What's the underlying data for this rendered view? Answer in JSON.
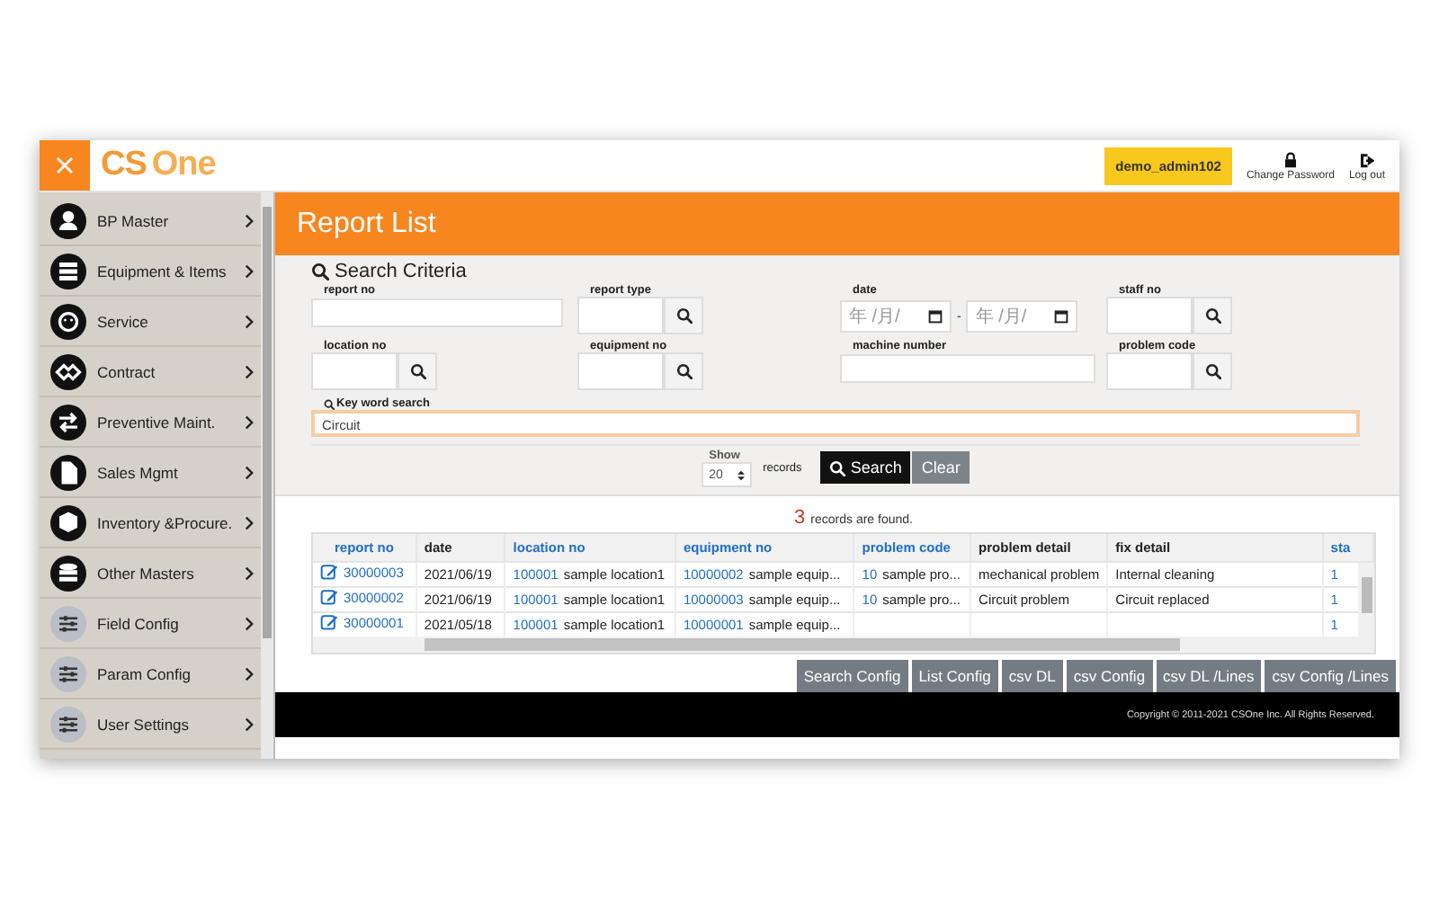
{
  "header": {
    "logo": [
      "CS",
      "One"
    ],
    "user": "demo_admin102",
    "actions": [
      {
        "kind": "password",
        "label": "Change Password"
      },
      {
        "kind": "logout",
        "label": "Log out"
      }
    ]
  },
  "sidebar": {
    "items": [
      {
        "label": "BP Master",
        "kind": "main"
      },
      {
        "label": "Equipment & Items",
        "kind": "main"
      },
      {
        "label": "Service",
        "kind": "main"
      },
      {
        "label": "Contract",
        "kind": "main"
      },
      {
        "label": "Preventive Maint.",
        "kind": "main"
      },
      {
        "label": "Sales Mgmt",
        "kind": "main"
      },
      {
        "label": "Inventory &Procure.",
        "kind": "main"
      },
      {
        "label": "Other Masters",
        "kind": "main"
      },
      {
        "label": "Field Config",
        "kind": "config"
      },
      {
        "label": "Param Config",
        "kind": "config"
      },
      {
        "label": "User Settings",
        "kind": "config"
      }
    ]
  },
  "page_title": "Report List",
  "search": {
    "title": "Search Criteria",
    "fields": [
      {
        "label": "report no",
        "kind": "text"
      },
      {
        "label": "report type",
        "kind": "lookup"
      },
      {
        "label": "date",
        "kind": "date_range",
        "placeholders": [
          "年 /月/",
          "年 /月/"
        ],
        "separator": "-"
      },
      {
        "label": "staff no",
        "kind": "lookup"
      },
      {
        "label": "location no",
        "kind": "lookup"
      },
      {
        "label": "equipment no",
        "kind": "lookup"
      },
      {
        "label": "machine number",
        "kind": "text"
      },
      {
        "label": "problem code",
        "kind": "lookup"
      },
      {
        "label": "Key word search",
        "kind": "keyword",
        "value": "Circuit"
      }
    ],
    "show": {
      "label": "Show",
      "value": "20",
      "suffix": "records"
    },
    "buttons": [
      {
        "label": "Search",
        "kind": "primary"
      },
      {
        "label": "Clear",
        "kind": "secondary"
      }
    ]
  },
  "results": {
    "count": "3",
    "count_text": "records are found.",
    "table": {
      "columns": [
        {
          "label": "report no",
          "sortable": true
        },
        {
          "label": "date",
          "sortable": false
        },
        {
          "label": "location no",
          "sortable": true
        },
        {
          "label": "equipment no",
          "sortable": true
        },
        {
          "label": "problem code",
          "sortable": true
        },
        {
          "label": "problem detail",
          "sortable": false
        },
        {
          "label": "fix detail",
          "sortable": false
        },
        {
          "label": "sta",
          "sortable": true
        }
      ],
      "rows": [
        [
          {
            "link": "30000003"
          },
          {
            "text": "2021/06/19"
          },
          {
            "link": "100001",
            "text": "sample location1"
          },
          {
            "link": "10000002",
            "text": "sample equip..."
          },
          {
            "link": "10",
            "text": "sample pro..."
          },
          {
            "text": "mechanical problem"
          },
          {
            "text": "Internal cleaning"
          },
          {
            "link": "1"
          }
        ],
        [
          {
            "link": "30000002"
          },
          {
            "text": "2021/06/19"
          },
          {
            "link": "100001",
            "text": "sample location1"
          },
          {
            "link": "10000003",
            "text": "sample equip..."
          },
          {
            "link": "10",
            "text": "sample pro..."
          },
          {
            "text": "Circuit problem"
          },
          {
            "text": "Circuit replaced"
          },
          {
            "link": "1"
          }
        ],
        [
          {
            "link": "30000001"
          },
          {
            "text": "2021/05/18"
          },
          {
            "link": "100001",
            "text": "sample location1"
          },
          {
            "link": "10000001",
            "text": "sample equip..."
          },
          {},
          {},
          {},
          {
            "link": "1"
          }
        ]
      ]
    },
    "buttons": [
      "Search Config",
      "List Config",
      "csv DL",
      "csv Config",
      "csv DL /Lines",
      "csv Config /Lines"
    ]
  },
  "footer": {
    "copyright": "Copyright © 2011-2021 CSOne Inc. All Rights Reserved."
  }
}
